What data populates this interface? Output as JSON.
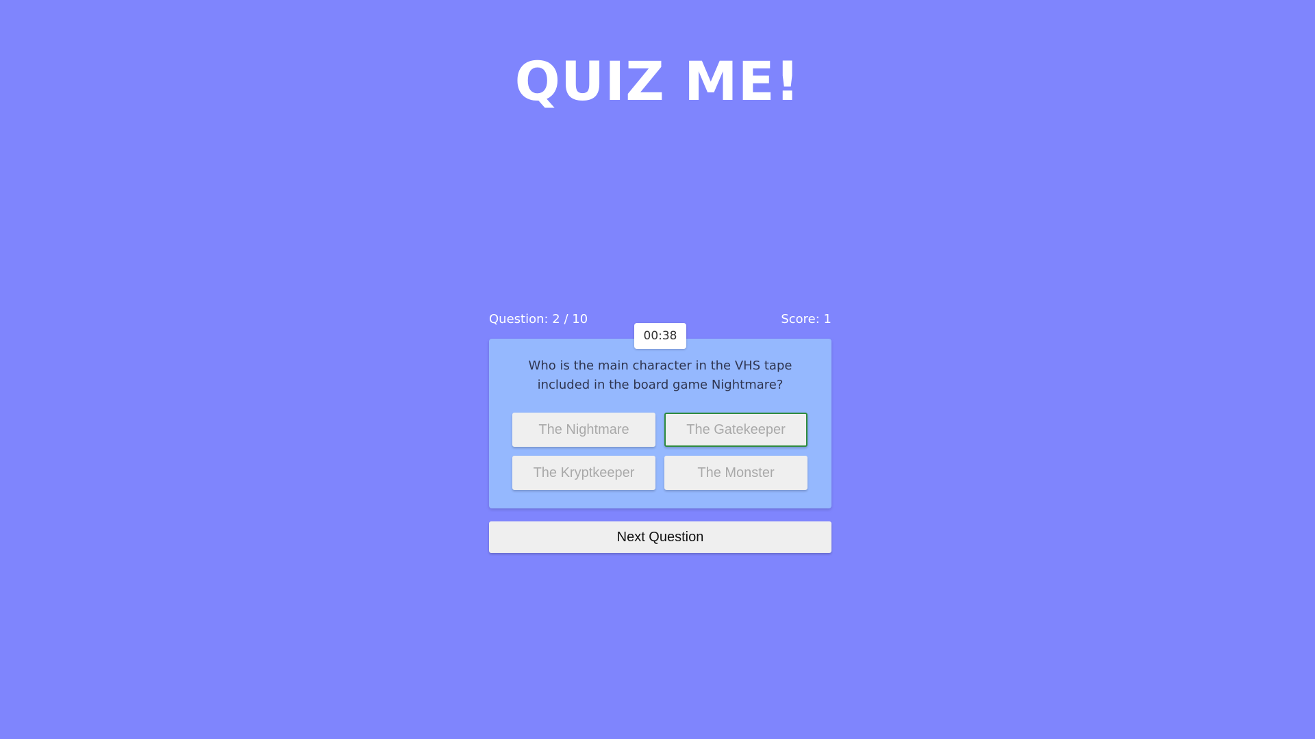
{
  "app": {
    "title": "QUIZ ME!"
  },
  "status": {
    "question_label": "Question: 2 / 10",
    "score_label": "Score: 1",
    "timer": "00:38"
  },
  "question": {
    "text": "Who is the main character in the VHS tape included in the board game Nightmare?",
    "answers": [
      {
        "label": "The Nightmare",
        "selected": false
      },
      {
        "label": "The Gatekeeper",
        "selected": true
      },
      {
        "label": "The Kryptkeeper",
        "selected": false
      },
      {
        "label": "The Monster",
        "selected": false
      }
    ]
  },
  "controls": {
    "next_label": "Next Question"
  },
  "colors": {
    "background": "#7f85fd",
    "card": "#95b8fe",
    "selected_border": "#2e8b3e",
    "button": "#efefef"
  }
}
